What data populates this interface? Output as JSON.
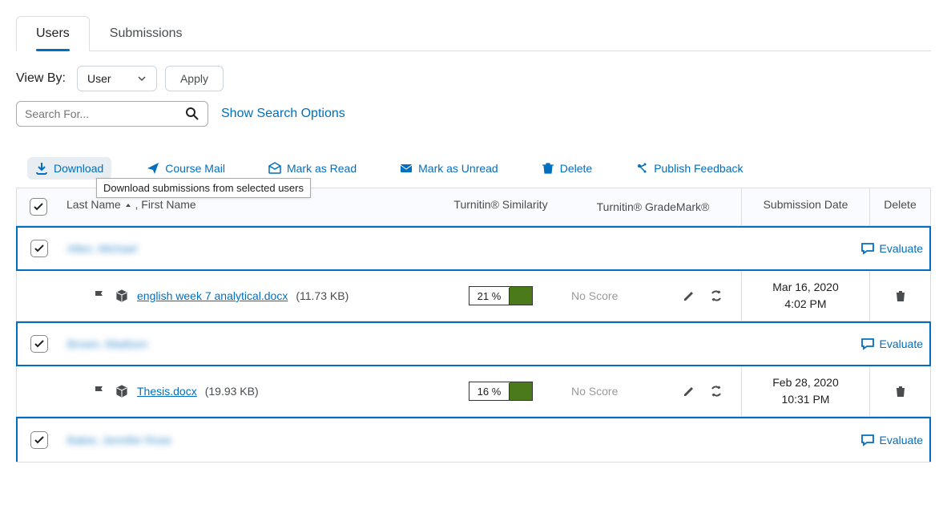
{
  "tabs": {
    "users": "Users",
    "submissions": "Submissions"
  },
  "filters": {
    "view_by_label": "View By:",
    "view_by_value": "User",
    "apply": "Apply"
  },
  "search": {
    "placeholder": "Search For...",
    "options_link": "Show Search Options"
  },
  "actions": {
    "download": "Download",
    "course_mail": "Course Mail",
    "mark_read": "Mark as Read",
    "mark_unread": "Mark as Unread",
    "delete": "Delete",
    "publish_feedback": "Publish Feedback",
    "download_tooltip": "Download submissions from selected users"
  },
  "headers": {
    "name": "Last Name",
    "name2": ", First Name",
    "similarity": "Turnitin® Similarity",
    "grademark": "Turnitin® GradeMark®",
    "date": "Submission Date",
    "delete": "Delete"
  },
  "evaluate_label": "Evaluate",
  "no_score": "No Score",
  "rows": [
    {
      "user": "Allen, Michael",
      "file": {
        "name": "english week 7 analytical.docx",
        "size": "(11.73 KB)"
      },
      "similarity": {
        "pct": "21 %",
        "color": "#4b7a1b"
      },
      "date_line1": "Mar 16, 2020",
      "date_line2": "4:02 PM"
    },
    {
      "user": "Brown, Madison",
      "file": {
        "name": "Thesis.docx",
        "size": "(19.93 KB)"
      },
      "similarity": {
        "pct": "16 %",
        "color": "#4b7a1b"
      },
      "date_line1": "Feb 28, 2020",
      "date_line2": "10:31 PM"
    },
    {
      "user": "Baker, Jennifer Rose"
    }
  ]
}
